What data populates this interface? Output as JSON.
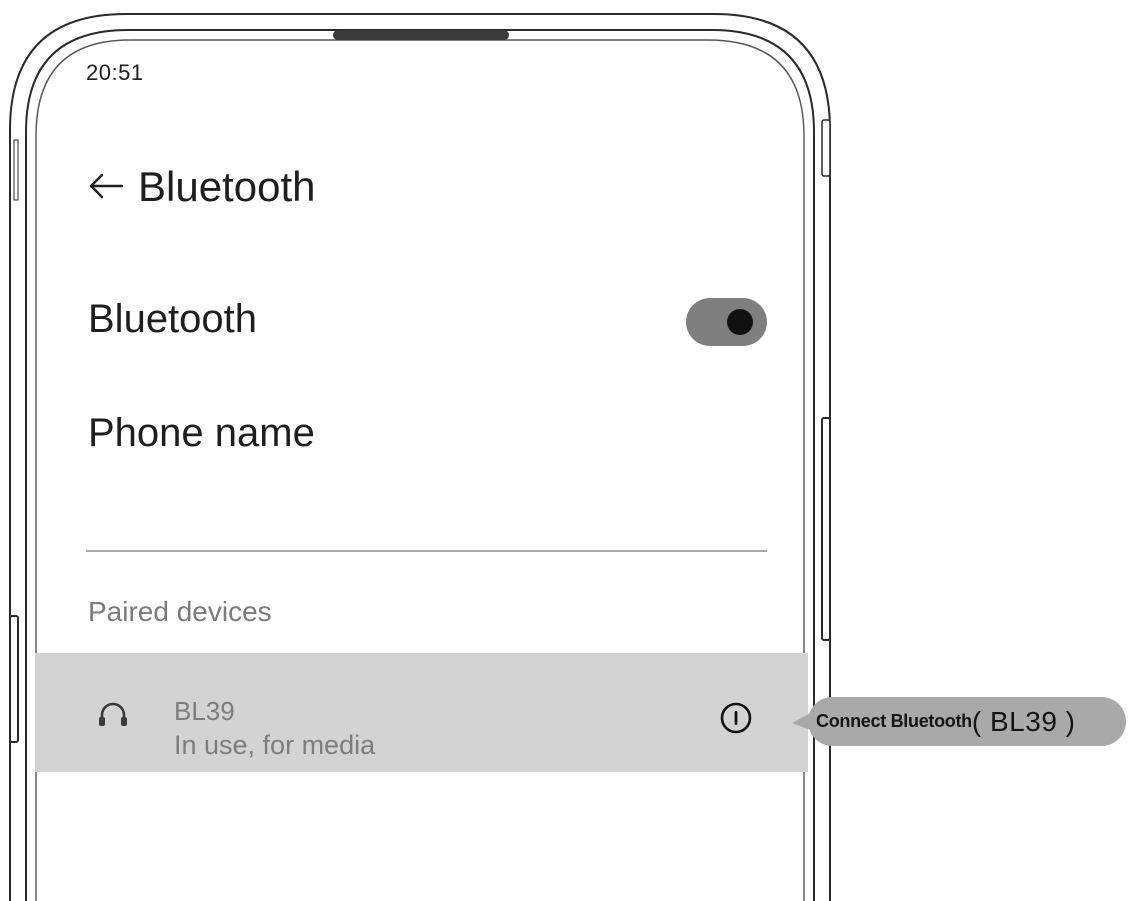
{
  "status_bar": {
    "time": "20:51"
  },
  "header": {
    "title": "Bluetooth",
    "back_icon": "arrow-left-icon"
  },
  "bluetooth_row": {
    "label": "Bluetooth",
    "toggle_on": true
  },
  "phone_name_row": {
    "label": "Phone name"
  },
  "paired_devices": {
    "header": "Paired devices",
    "items": [
      {
        "name": "BL39",
        "status": "In use, for media",
        "icon": "headphones-icon",
        "action_icon": "info-icon"
      }
    ]
  },
  "callout": {
    "text": "Connect Bluetooth",
    "device": "( BL39 )"
  },
  "colors": {
    "toggle_track": "#7f7f7f",
    "toggle_knob": "#111111",
    "highlight_row": "#d3d3d3",
    "callout_bg": "#a9a9a9",
    "muted_text": "#7d7d7d"
  }
}
